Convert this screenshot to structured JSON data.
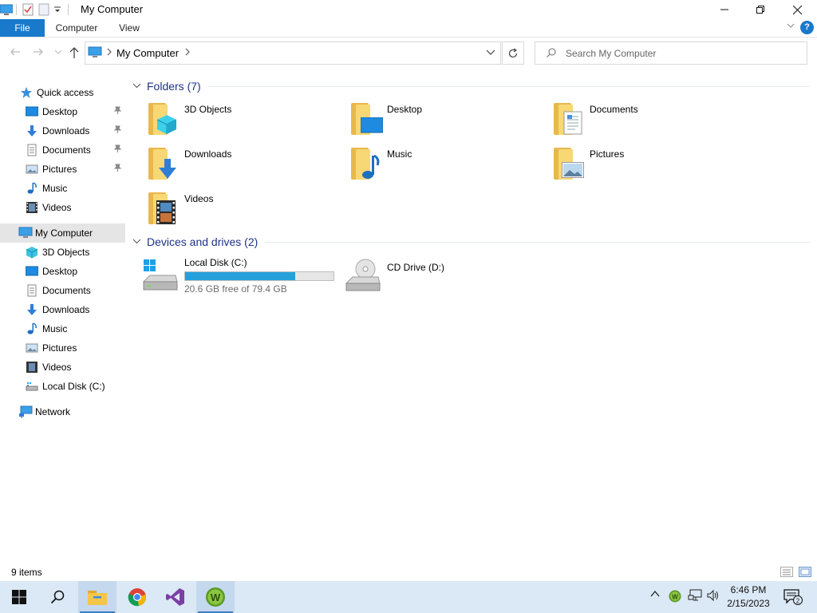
{
  "window": {
    "title": "My Computer",
    "minimize_icon": "minimize-icon",
    "maximize_icon": "restore-icon",
    "close_icon": "close-icon"
  },
  "ribbon": {
    "tabs": [
      "File",
      "Computer",
      "View"
    ],
    "help": "?"
  },
  "nav": {
    "address": "My Computer",
    "search_placeholder": "Search My Computer"
  },
  "sidebar": {
    "quick_access": {
      "label": "Quick access",
      "items": [
        "Desktop",
        "Downloads",
        "Documents",
        "Pictures",
        "Music",
        "Videos"
      ]
    },
    "my_computer": {
      "label": "My Computer",
      "items": [
        "3D Objects",
        "Desktop",
        "Documents",
        "Downloads",
        "Music",
        "Pictures",
        "Videos",
        "Local Disk (C:)"
      ]
    },
    "network": {
      "label": "Network"
    }
  },
  "content": {
    "folders_header": "Folders (7)",
    "folders": [
      "3D Objects",
      "Desktop",
      "Documents",
      "Downloads",
      "Music",
      "Pictures",
      "Videos"
    ],
    "devices_header": "Devices and drives (2)",
    "drives": [
      {
        "name": "Local Disk (C:)",
        "free_text": "20.6 GB free of 79.4 GB",
        "used_fraction": 0.74
      },
      {
        "name": "CD Drive (D:)"
      }
    ]
  },
  "status": {
    "items": "9 items"
  },
  "taskbar": {
    "time": "6:46 PM",
    "date": "2/15/2023",
    "notification_count": "2"
  },
  "colors": {
    "accent": "#1979ca",
    "folder": "#f8d775",
    "drive_bar": "#26a0da",
    "header_text": "#1e3287"
  }
}
